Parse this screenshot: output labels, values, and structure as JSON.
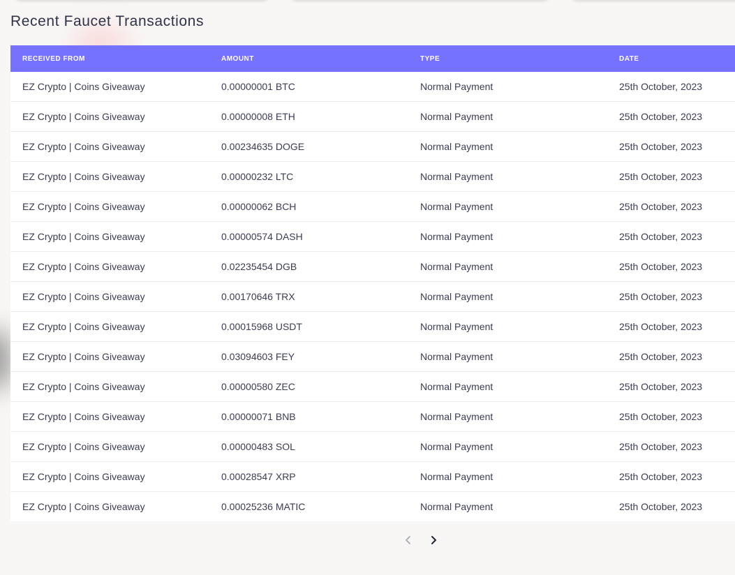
{
  "section": {
    "title": "Recent Faucet Transactions"
  },
  "table": {
    "columns": [
      "RECEIVED FROM",
      "AMOUNT",
      "TYPE",
      "DATE"
    ],
    "rows": [
      {
        "from": "EZ Crypto | Coins Giveaway",
        "amount": "0.00000001 BTC",
        "type": "Normal Payment",
        "date": "25th October, 2023"
      },
      {
        "from": "EZ Crypto | Coins Giveaway",
        "amount": "0.00000008 ETH",
        "type": "Normal Payment",
        "date": "25th October, 2023"
      },
      {
        "from": "EZ Crypto | Coins Giveaway",
        "amount": "0.00234635 DOGE",
        "type": "Normal Payment",
        "date": "25th October, 2023"
      },
      {
        "from": "EZ Crypto | Coins Giveaway",
        "amount": "0.00000232 LTC",
        "type": "Normal Payment",
        "date": "25th October, 2023"
      },
      {
        "from": "EZ Crypto | Coins Giveaway",
        "amount": "0.00000062 BCH",
        "type": "Normal Payment",
        "date": "25th October, 2023"
      },
      {
        "from": "EZ Crypto | Coins Giveaway",
        "amount": "0.00000574 DASH",
        "type": "Normal Payment",
        "date": "25th October, 2023"
      },
      {
        "from": "EZ Crypto | Coins Giveaway",
        "amount": "0.02235454 DGB",
        "type": "Normal Payment",
        "date": "25th October, 2023"
      },
      {
        "from": "EZ Crypto | Coins Giveaway",
        "amount": "0.00170646 TRX",
        "type": "Normal Payment",
        "date": "25th October, 2023"
      },
      {
        "from": "EZ Crypto | Coins Giveaway",
        "amount": "0.00015968 USDT",
        "type": "Normal Payment",
        "date": "25th October, 2023"
      },
      {
        "from": "EZ Crypto | Coins Giveaway",
        "amount": "0.03094603 FEY",
        "type": "Normal Payment",
        "date": "25th October, 2023"
      },
      {
        "from": "EZ Crypto | Coins Giveaway",
        "amount": "0.00000580 ZEC",
        "type": "Normal Payment",
        "date": "25th October, 2023"
      },
      {
        "from": "EZ Crypto | Coins Giveaway",
        "amount": "0.00000071 BNB",
        "type": "Normal Payment",
        "date": "25th October, 2023"
      },
      {
        "from": "EZ Crypto | Coins Giveaway",
        "amount": "0.00000483 SOL",
        "type": "Normal Payment",
        "date": "25th October, 2023"
      },
      {
        "from": "EZ Crypto | Coins Giveaway",
        "amount": "0.00028547 XRP",
        "type": "Normal Payment",
        "date": "25th October, 2023"
      },
      {
        "from": "EZ Crypto | Coins Giveaway",
        "amount": "0.00025236 MATIC",
        "type": "Normal Payment",
        "date": "25th October, 2023"
      }
    ]
  },
  "pagination": {
    "prev_icon": "chevron-left-icon",
    "next_icon": "chevron-right-icon",
    "prev_disabled": true
  },
  "colors": {
    "header_bg": "#7671ff",
    "page_bg": "#f8f7f5",
    "text": "#3a3d52"
  }
}
